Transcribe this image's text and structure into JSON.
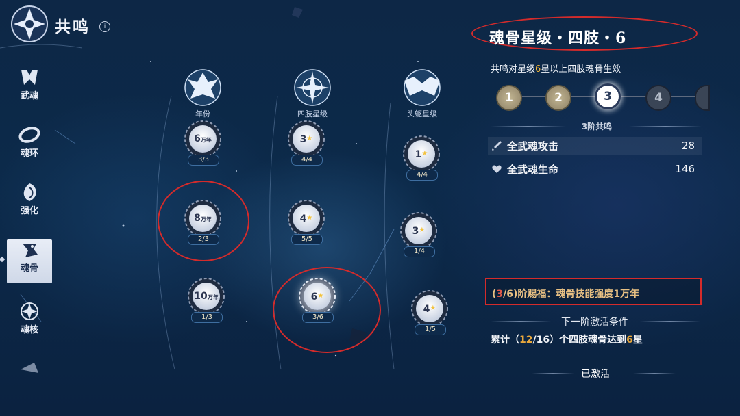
{
  "header": {
    "title": "共鸣",
    "info_glyph": "i"
  },
  "sidebar": {
    "items": [
      {
        "label": "武魂",
        "icon": "martial-soul-icon"
      },
      {
        "label": "魂环",
        "icon": "soul-ring-icon"
      },
      {
        "label": "强化",
        "icon": "enhance-icon"
      },
      {
        "label": "魂骨",
        "icon": "soul-bone-icon",
        "active": true
      },
      {
        "label": "魂核",
        "icon": "soul-core-icon"
      }
    ]
  },
  "columns": [
    {
      "label": "年份",
      "nodes": [
        {
          "value": "6",
          "unit": "万年",
          "count": "3/3"
        },
        {
          "value": "8",
          "unit": "万年",
          "count": "2/3"
        },
        {
          "value": "10",
          "unit": "万年",
          "count": "1/3"
        }
      ]
    },
    {
      "label": "四肢星级",
      "nodes": [
        {
          "value": "3",
          "count": "4/4"
        },
        {
          "value": "4",
          "count": "5/5"
        },
        {
          "value": "6",
          "count": "3/6"
        }
      ]
    },
    {
      "label": "头躯星级",
      "nodes": [
        {
          "value": "1",
          "count": "4/4"
        },
        {
          "value": "3",
          "count": "1/4"
        },
        {
          "value": "4",
          "count": "1/5"
        }
      ]
    }
  ],
  "panel": {
    "title": "魂骨星级・四肢・6",
    "desc_pre": "共鸣对星级",
    "desc_num": "6",
    "desc_post": "星以上四肢魂骨生效",
    "tiers": [
      "1",
      "2",
      "3",
      "4"
    ],
    "current_tier": 3,
    "tier_name": "3阶共鸣",
    "stats": [
      {
        "label": "全武魂攻击",
        "value": "28",
        "icon": "sword-icon"
      },
      {
        "label": "全武魂生命",
        "value": "146",
        "icon": "heart-icon"
      }
    ],
    "bonus": {
      "open": "(",
      "cur": "3",
      "total": "/6)",
      "text": "阶赐福：魂骨技能强度1万年"
    },
    "next_title": "下一阶激活条件",
    "requirement": {
      "pre": "累计（",
      "cur": "12",
      "post": "/16）个四肢魂骨达到",
      "num": "6",
      "end": "星"
    },
    "status": "已激活"
  }
}
